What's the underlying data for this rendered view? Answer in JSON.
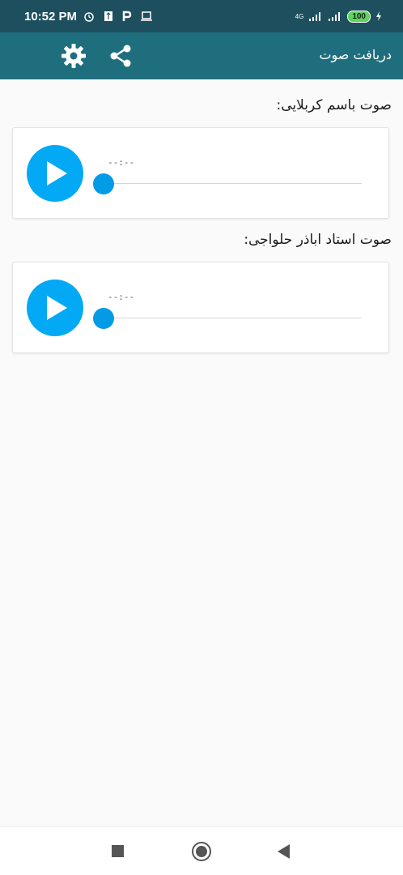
{
  "status_bar": {
    "time": "10:52 PM",
    "network": "4G",
    "battery": "100",
    "icons_left": [
      "alarm-icon",
      "usb-icon",
      "p-icon",
      "laptop-icon"
    ],
    "icons_right": [
      "signal-icon",
      "signal-icon",
      "battery-icon",
      "charging-icon"
    ]
  },
  "app_bar": {
    "title": "دریافت صوت",
    "actions": [
      "settings-icon",
      "share-icon"
    ],
    "background": "#1f6e7e"
  },
  "tracks": [
    {
      "label": "صوت باسم کربلایی:",
      "time": "--:--",
      "progress": 0
    },
    {
      "label": "صوت استاد  اباذر حلواجی:",
      "time": "--:--",
      "progress": 0
    }
  ],
  "colors": {
    "accent": "#03a9f4",
    "thumb": "#039be5",
    "status_bar": "#1d4f5f"
  }
}
